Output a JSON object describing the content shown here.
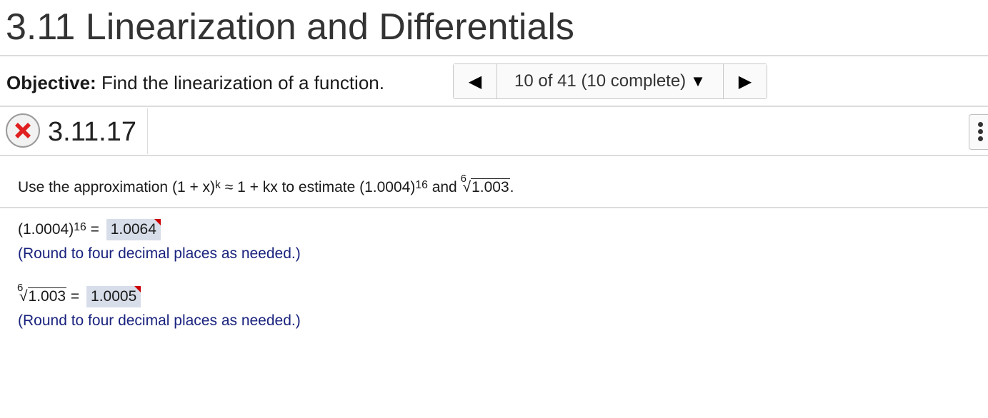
{
  "header": {
    "title": "3.11 Linearization and Differentials"
  },
  "objective": {
    "label": "Objective:",
    "text": "Find the linearization of a function."
  },
  "nav": {
    "position_text": "10 of 41 (10 complete)"
  },
  "question": {
    "number": "3.11.17",
    "status": "incorrect"
  },
  "prompt": {
    "part1": "Use the approximation (1 + x)",
    "exp_k": "k",
    "part2": " ≈ 1 + kx to estimate (1.0004)",
    "exp_16": "16",
    "part3": " and ",
    "root_index": "6",
    "root_arg": "1.003",
    "part4": "."
  },
  "answers": [
    {
      "base": "(1.0004)",
      "exp": "16",
      "equals": " = ",
      "value": "1.0064",
      "hint": "(Round to four decimal places as needed.)"
    },
    {
      "root_index": "6",
      "root_arg": "1.003",
      "equals": " = ",
      "value": "1.0005",
      "hint": "(Round to four decimal places as needed.)"
    }
  ],
  "colors": {
    "hint_text": "#1a237e",
    "answer_bg": "#d7dde9",
    "flag": "#cc0000",
    "incorrect_icon": "#e02020"
  },
  "icons": {
    "status": "x-circle-icon",
    "prev": "triangle-left-icon",
    "next": "triangle-right-icon",
    "dropdown": "triangle-down-icon",
    "more": "vertical-dots-icon"
  }
}
